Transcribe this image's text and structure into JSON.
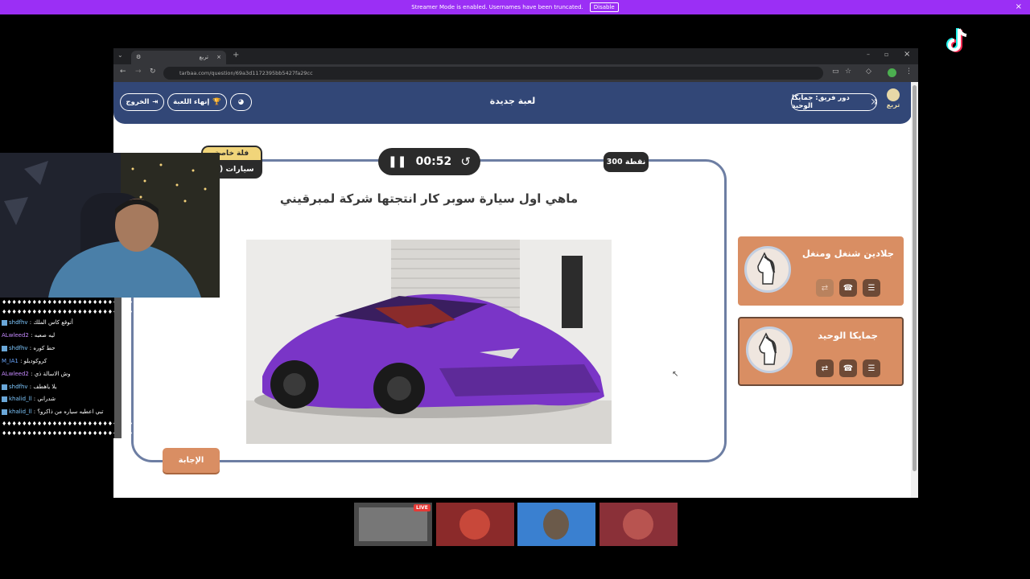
{
  "banner": {
    "message": "Streamer Mode is enabled. Usernames have been truncated.",
    "disable_label": "Disable",
    "close": "×"
  },
  "browser": {
    "tab_title": "تربع",
    "url": "tarbaa.com/question/69a3d1172395bb5427fa29cc"
  },
  "site": {
    "logo_text": "تربع",
    "team_turn": "دور فريق: جمايكا الوحيد",
    "title": "لعبة جديدة",
    "end_game": "إنهاء اللعبة",
    "exit": "الخروج"
  },
  "question": {
    "category_top": "فلة خاصة",
    "category": "سيارات (صـ",
    "timer": "00:52",
    "points": "300 نقطة",
    "text": "ماهي اول سيارة سوبر كار انتجتها شركة لمبرقيني",
    "answer_button": "الإجابة"
  },
  "teams": [
    {
      "name": "جلادين شنغل ومنغل"
    },
    {
      "name": "جمايكا الوحيد"
    }
  ],
  "chat": [
    {
      "user": "",
      "text": "♦♦♦♦♦♦♦♦♦♦♦♦♦♦♦♦♦♦♦♦♦♦♦♦♦♦♦♦♦♦♦♦♦♦♦♦♦♦♦♦",
      "color": "#ffffff"
    },
    {
      "user": "",
      "text": "♦♦♦♦♦♦♦♦♦♦♦♦♦♦♦♦♦♦♦♦♦♦♦♦♦♦♦♦♦♦",
      "color": "#ffffff"
    },
    {
      "user": "shdfhv",
      "text": "أتوقع كاس الملك",
      "color": "#7ec8ff"
    },
    {
      "user": "ALwleed2",
      "text": "ليه صعبه",
      "color": "#c58aff"
    },
    {
      "user": "shdfhv",
      "text": "حط كوره",
      "color": "#7ec8ff"
    },
    {
      "user": "M_IA1",
      "text": "كروكوديلو",
      "color": "#6aa7ff"
    },
    {
      "user": "ALwleed2",
      "text": "وش الاسالة ذي",
      "color": "#c58aff"
    },
    {
      "user": "shdfhv",
      "text": "يلا ياهطف",
      "color": "#7ec8ff"
    },
    {
      "user": "khalid_ll",
      "text": "شدراني",
      "color": "#7ec8ff"
    },
    {
      "user": "khalid_ll",
      "text": "تبي اعطيه سياره من ذاكرو؟",
      "color": "#7ec8ff"
    },
    {
      "user": "",
      "text": "♦♦♦♦♦♦♦♦♦♦♦♦♦♦♦♦♦♦♦♦♦♦♦♦♦♦♦♦♦♦♦♦♦♦♦♦♦♦♦♦",
      "color": "#ffffff"
    },
    {
      "user": "",
      "text": "♦♦♦♦♦♦♦♦♦♦♦♦♦♦♦♦♦♦♦♦♦♦♦♦♦♦♦♦",
      "color": "#ffffff"
    }
  ],
  "thumbs": {
    "live_badge": "LIVE"
  },
  "colors": {
    "header": "#324777",
    "accent": "#d98e63",
    "banner": "#9b2ff5"
  }
}
